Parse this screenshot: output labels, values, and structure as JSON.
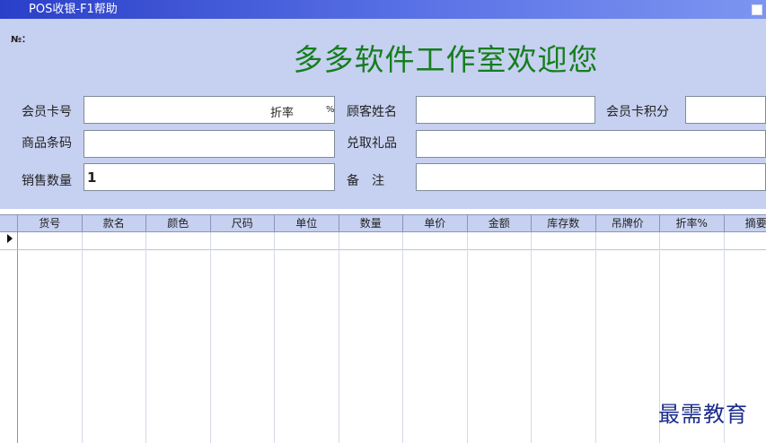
{
  "window": {
    "title": "POS收银-F1帮助"
  },
  "header": {
    "no_label": "№：",
    "welcome": "多多软件工作室欢迎您"
  },
  "form": {
    "member_card_label": "会员卡号",
    "member_card_value": "",
    "discount_label": "折率",
    "discount_unit": "%",
    "customer_name_label": "顾客姓名",
    "customer_name_value": "",
    "member_points_label": "会员卡积分",
    "member_points_value": "",
    "barcode_label": "商品条码",
    "barcode_value": "",
    "gift_label": "兑取礼品",
    "gift_value": "",
    "quantity_label": "销售数量",
    "quantity_value": "1",
    "remark_label": "备　注",
    "remark_value": ""
  },
  "grid": {
    "columns": [
      "货号",
      "款名",
      "颜色",
      "尺码",
      "单位",
      "数量",
      "单价",
      "金额",
      "库存数",
      "吊牌价",
      "折率%",
      "摘要"
    ]
  },
  "watermark": "最需教育"
}
